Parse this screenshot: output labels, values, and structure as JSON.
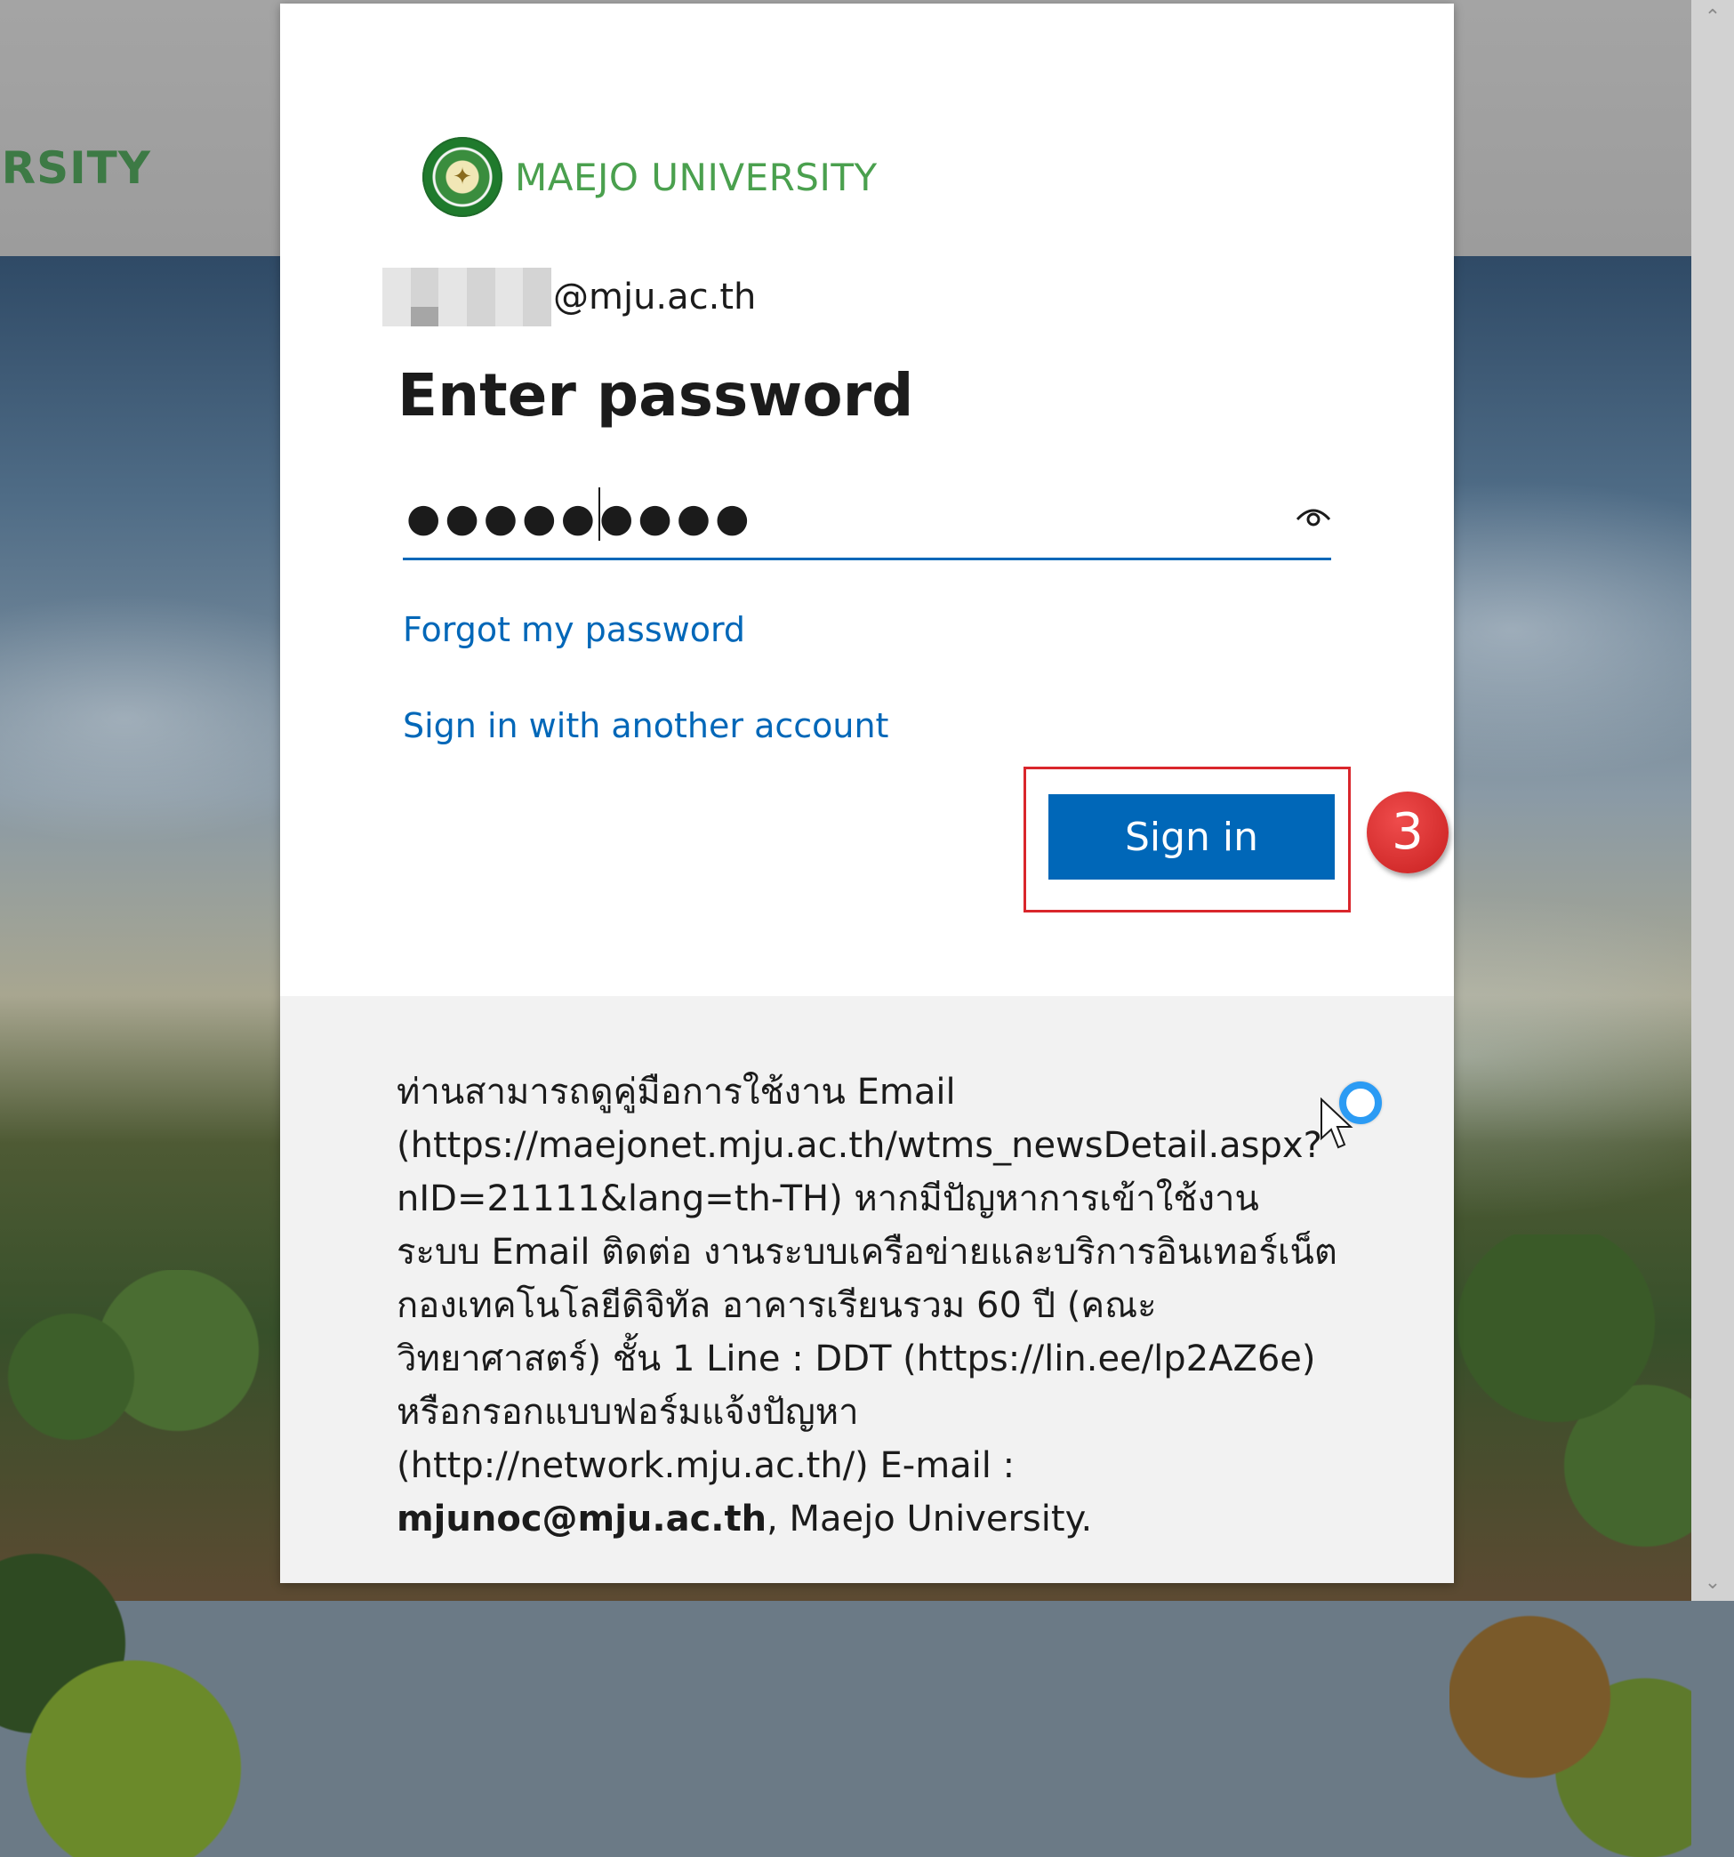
{
  "background": {
    "brand_text": "MAEJO UNIVERSITY",
    "scroll_up_icon": "chevron-up-icon",
    "scroll_down_icon": "chevron-down-icon"
  },
  "dialog": {
    "logo": {
      "seal_icon": "university-seal-icon",
      "text": "MAEJO UNIVERSITY"
    },
    "account_domain": "@mju.ac.th",
    "title": "Enter password",
    "password": {
      "value": "●●●●●●●●●",
      "reveal_icon": "eye-icon"
    },
    "forgot_link": "Forgot my password",
    "other_account_link": "Sign in with another account",
    "signin_button": "Sign in",
    "step_badge": "3",
    "colors": {
      "accent": "#0067b8",
      "highlight": "#d9262c",
      "brand_green": "#4aa04e"
    }
  },
  "info": {
    "text": "ท่านสามารถดูคู่มือการใช้งาน Email (https://maejonet.mju.ac.th/wtms_newsDetail.aspx?nID=21111&lang=th-TH) หากมีปัญหาการเข้าใช้งาน ระบบ Email ติดต่อ งานระบบเครือข่ายและบริการอินเทอร์เน็ต กองเทคโนโลยีดิจิทัล อาคารเรียนรวม 60 ปี (คณะวิทยาศาสตร์) ชั้น 1 Line : DDT (https://lin.ee/lp2AZ6e) หรือกรอกแบบฟอร์มแจ้งปัญหา (http://network.mju.ac.th/) E-mail : ",
    "email": "mjunoc@mju.ac.th",
    "suffix": ", Maejo University."
  }
}
